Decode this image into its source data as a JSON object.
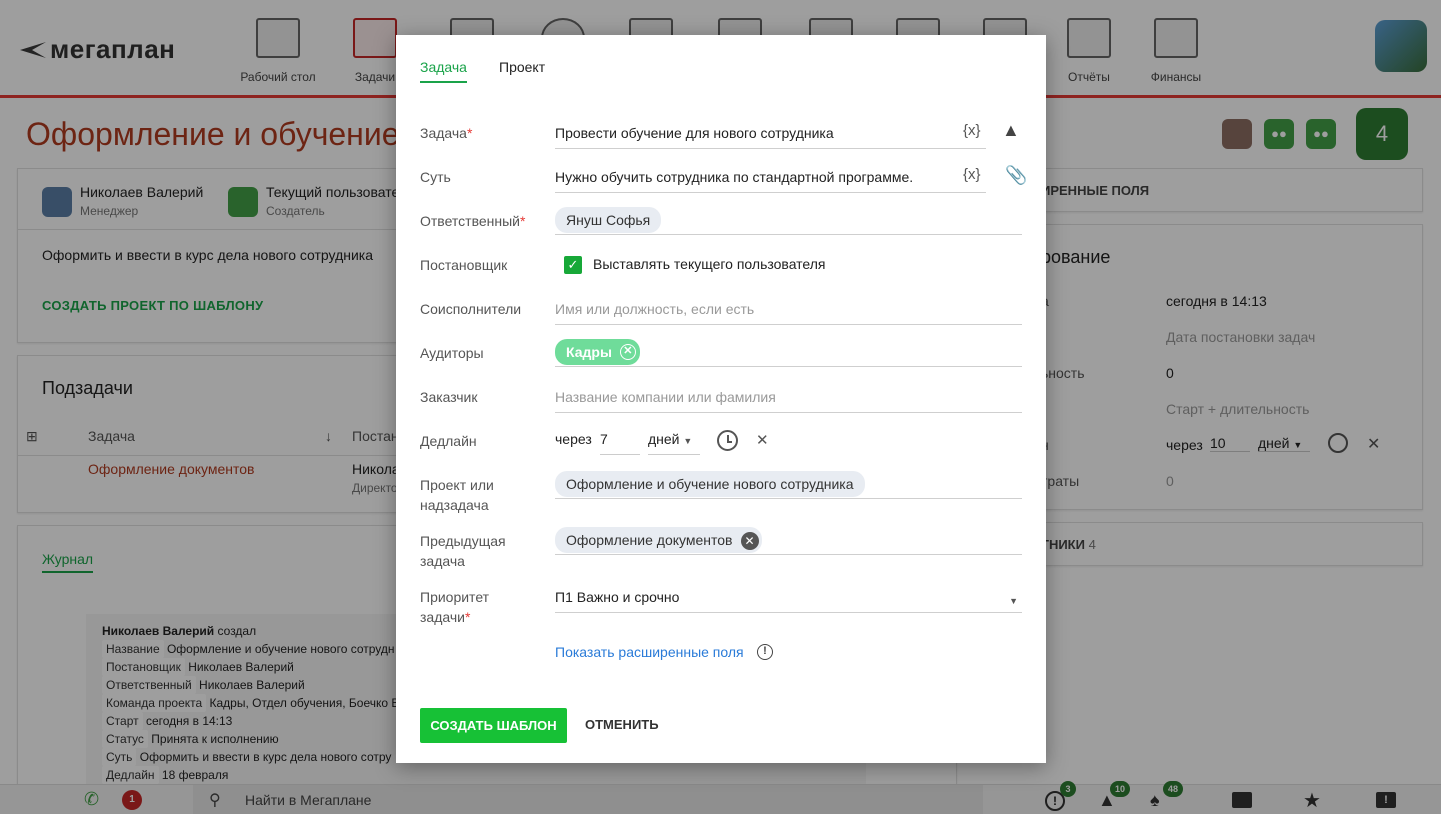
{
  "brand": {
    "name": "мегаплан"
  },
  "nav": [
    {
      "label": "Рабочий стол",
      "icon": "desktop-icon"
    },
    {
      "label": "Задачи",
      "icon": "tasks-icon"
    },
    {
      "label": "",
      "icon": "documents-icon"
    },
    {
      "label": "",
      "icon": "clock-icon"
    },
    {
      "label": "",
      "icon": "messages-icon"
    },
    {
      "label": "",
      "icon": "files-icon"
    },
    {
      "label": "",
      "icon": "contacts-icon"
    },
    {
      "label": "",
      "icon": "deals-icon"
    },
    {
      "label": "",
      "icon": "docs-icon"
    },
    {
      "label": "Отчёты",
      "icon": "reports-icon"
    },
    {
      "label": "Финансы",
      "icon": "finance-icon"
    }
  ],
  "page": {
    "title": "Оформление и обучение",
    "manager_name": "Николаев Валерий",
    "manager_role": "Менеджер",
    "creator_name": "Текущий пользовате",
    "creator_role": "Создатель",
    "description": "Оформить и ввести в курс дела нового сотрудника",
    "create_project_link": "СОЗДАТЬ ПРОЕКТ ПО ШАБЛОНУ",
    "subtasks_title": "Подзадачи",
    "subtasks_col_task": "Задача",
    "subtasks_col_assignee": "Постан",
    "subtask_row_name": "Оформление документов",
    "subtask_row_person": "Никола",
    "subtask_row_role": "Директо",
    "journal_tab": "Журнал",
    "journal_author": "Николаев Валерий",
    "journal_action": "создал",
    "journal_entries": [
      {
        "k": "Название",
        "v": "Оформление и обучение нового сотрудн"
      },
      {
        "k": "Постановщик",
        "v": "Николаев Валерий"
      },
      {
        "k": "Ответственный",
        "v": "Николаев Валерий"
      },
      {
        "k": "Команда проекта",
        "v": "Кадры, Отдел обучения, Боечко В"
      },
      {
        "k": "Старт",
        "v": "сегодня в 14:13"
      },
      {
        "k": "Статус",
        "v": "Принята к исполнению"
      },
      {
        "k": "Суть",
        "v": "Оформить и ввести в курс дела нового сотру"
      },
      {
        "k": "Дедлайн",
        "v": "18 февраля"
      }
    ],
    "right_ext_fields": "ИРЕННЫЕ ПОЛЯ",
    "right_planning": "рование",
    "right_rows": [
      {
        "k": "а",
        "v": "сегодня в 14:13"
      },
      {
        "k": "",
        "v": "Дата постановки задач"
      },
      {
        "k": "ьность",
        "v": "0"
      },
      {
        "k": "",
        "v": "Старт + длительность"
      },
      {
        "k": "н",
        "v": ""
      },
      {
        "k": "траты",
        "v": "0"
      }
    ],
    "right_deadline_via": "через",
    "right_deadline_num": "10",
    "right_deadline_unit": "дней",
    "right_participants": "ТНИКИ",
    "right_participants_count": "4",
    "team_count": "4"
  },
  "modal": {
    "tab_task": "Задача",
    "tab_project": "Проект",
    "task_label": "Задача",
    "task_value": "Провести обучение для нового сотрудника",
    "essence_label": "Суть",
    "essence_value": "Нужно обучить сотрудника по стандартной программе.",
    "var_icon": "{x}",
    "responsible_label": "Ответственный",
    "responsible_value": "Януш Софья",
    "setter_label": "Постановщик",
    "setter_checkbox_label": "Выставлять текущего пользователя",
    "coexec_label": "Соисполнители",
    "coexec_placeholder": "Имя или должность, если есть",
    "auditors_label": "Аудиторы",
    "auditors_value": "Кадры",
    "customer_label": "Заказчик",
    "customer_placeholder": "Название компании или фамилия",
    "deadline_label": "Дедлайн",
    "deadline_via": "через",
    "deadline_num": "7",
    "deadline_unit": "дней",
    "project_label_1": "Проект или",
    "project_label_2": "надзадача",
    "project_value": "Оформление и обучение нового сотрудника",
    "prev_label_1": "Предыдущая",
    "prev_label_2": "задача",
    "prev_value": "Оформление документов",
    "priority_label_1": "Приоритет",
    "priority_label_2": "задачи",
    "priority_value": "П1 Важно и срочно",
    "show_ext_link": "Показать расширенные поля",
    "create_button": "СОЗДАТЬ ШАБЛОН",
    "cancel_button": "ОТМЕНИТЬ"
  },
  "bottombar": {
    "calls_badge": "1",
    "search_placeholder": "Найти в Мегаплане",
    "alerts_badge": "3",
    "hot_badge": "10",
    "notif_badge": "48"
  },
  "colors": {
    "accent": "#1aa34a",
    "brand_red": "#e53935",
    "button_green": "#17c136"
  }
}
